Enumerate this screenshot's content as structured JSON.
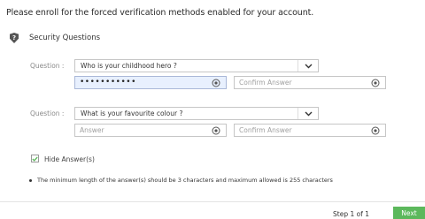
{
  "heading": "Please enroll for the forced verification methods enabled for your account.",
  "section": {
    "icon": "shield-question-icon",
    "title": "Security Questions"
  },
  "questions": [
    {
      "label": "Question :",
      "selected": "Who is your childhood hero ?",
      "answer_value": "•••••••••••",
      "answer_placeholder": "Answer",
      "confirm_placeholder": "Confirm Answer"
    },
    {
      "label": "Question :",
      "selected": "What is your favourite colour ?",
      "answer_value": "",
      "answer_placeholder": "Answer",
      "confirm_placeholder": "Confirm Answer"
    }
  ],
  "hide_answers": {
    "label": "Hide Answer(s)",
    "checked": true
  },
  "note": "The minimum length of the answer(s) should be 3 characters and maximum allowed is 255 characters",
  "footer": {
    "step": "Step 1 of 1",
    "next_label": "Next"
  },
  "colors": {
    "accent": "#5cb85c",
    "focus_bg": "#e8f0fe"
  }
}
